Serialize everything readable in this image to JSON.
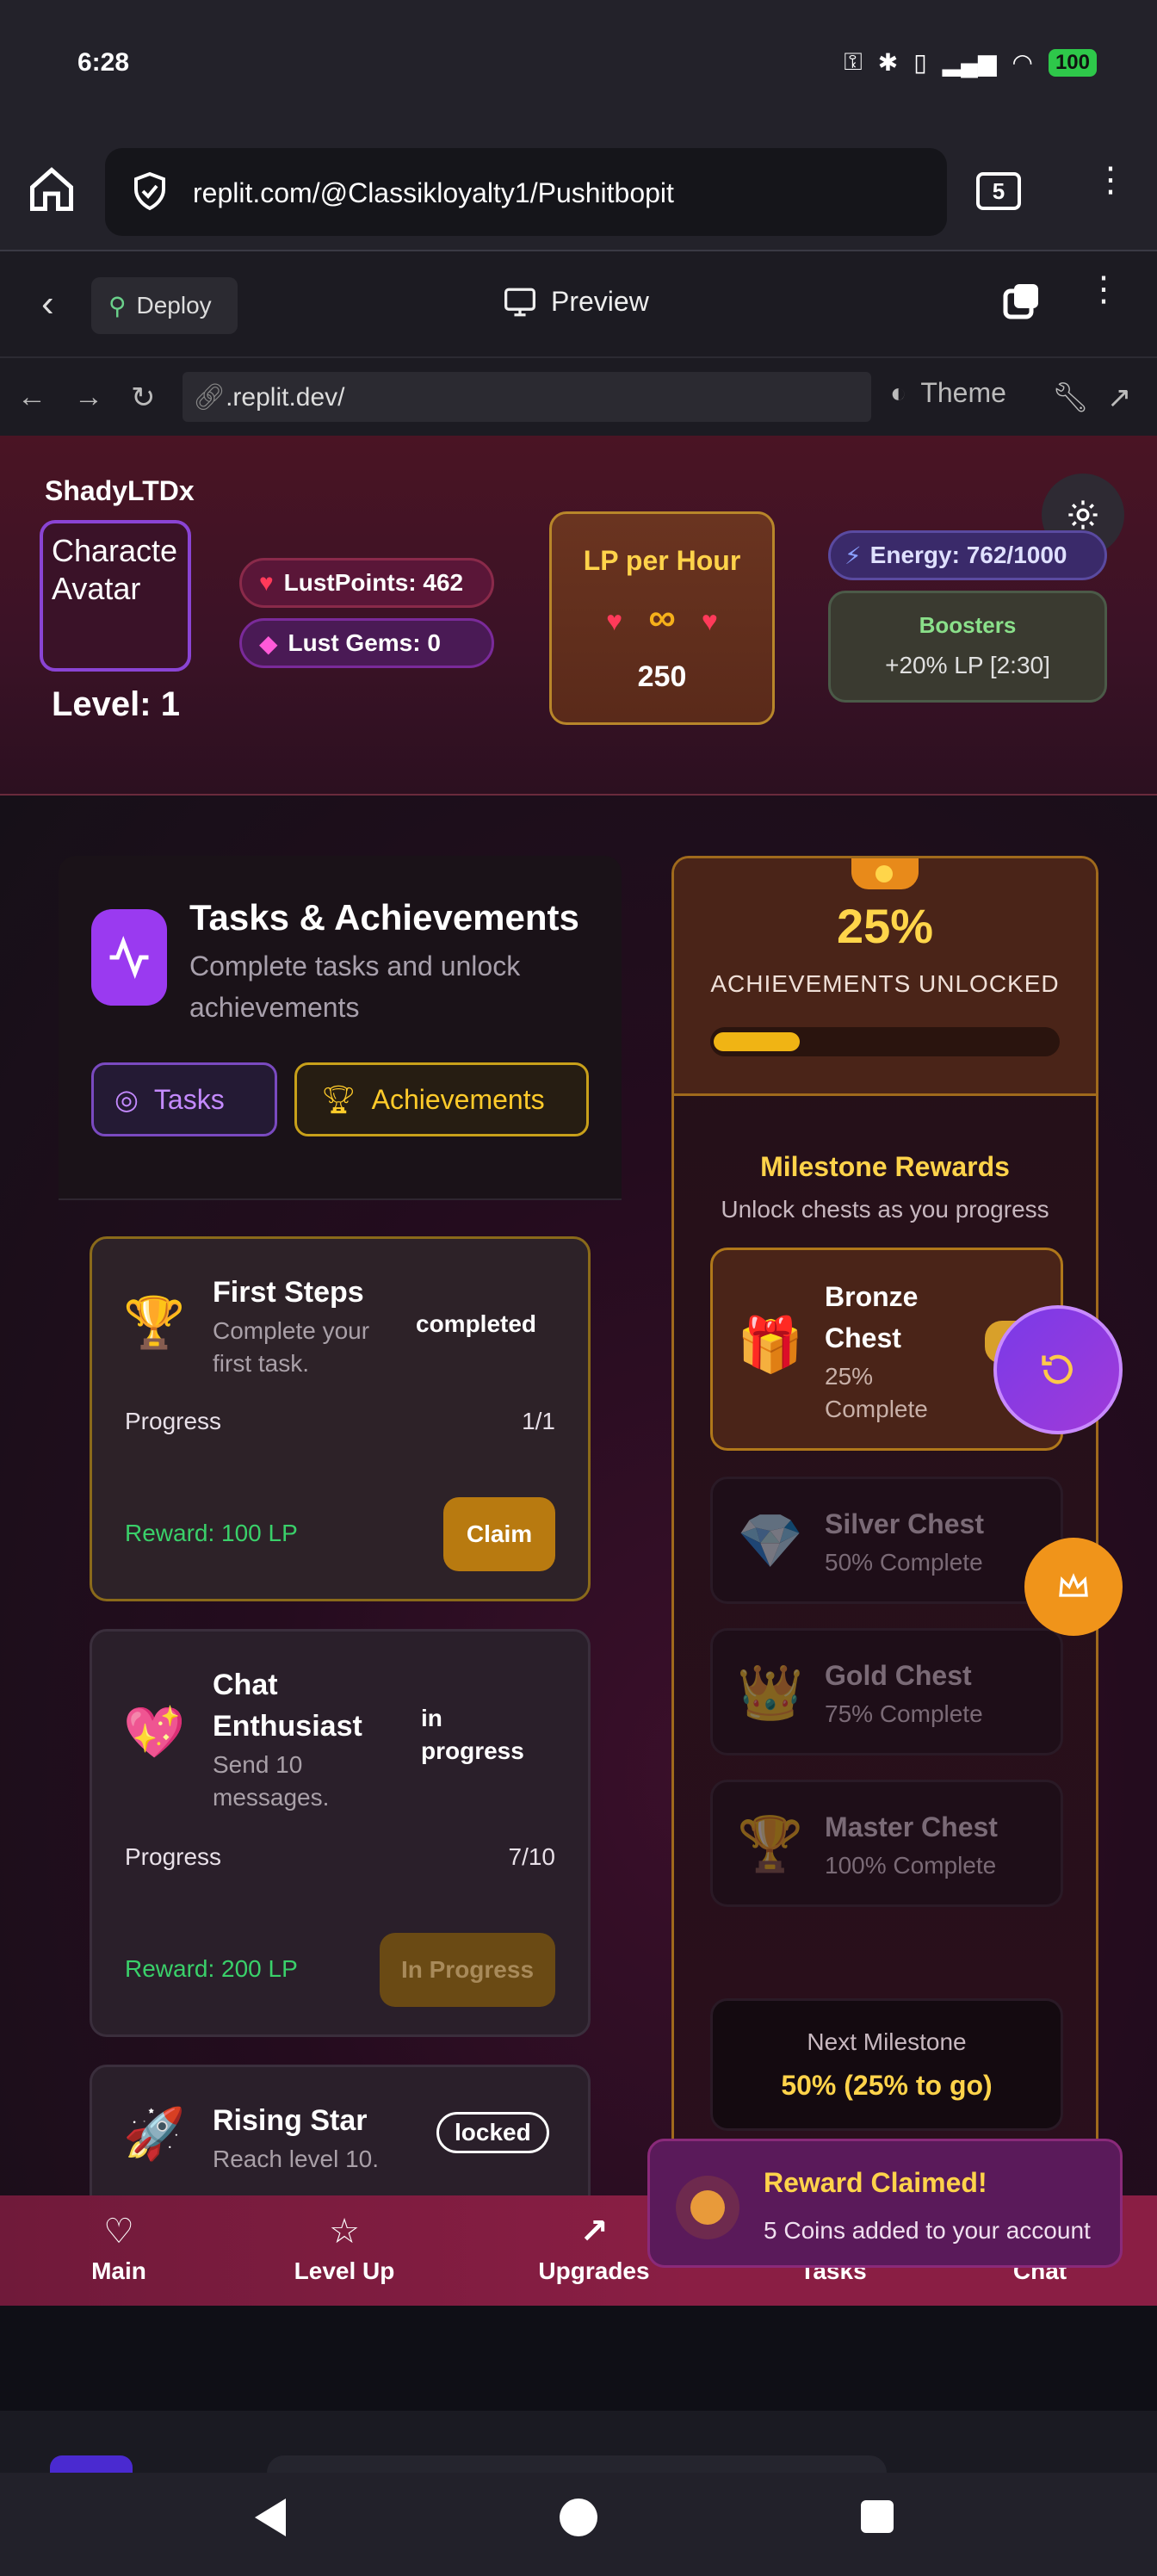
{
  "status_bar": {
    "time": "6:28",
    "battery": "100"
  },
  "browser": {
    "url": "replit.com/@Classikloyalty1/Pushitbopit",
    "tab_count": "5"
  },
  "replit": {
    "deploy_label": "Deploy",
    "preview_label": "Preview",
    "address": ".replit.dev/",
    "theme_label": "Theme"
  },
  "header": {
    "username": "ShadyLTDx",
    "avatar_text": "Characte Avatar",
    "level": "Level: 1",
    "lust_points": "LustPoints: 462",
    "lust_gems": "Lust Gems: 0",
    "lp_hour_title": "LP per Hour",
    "lp_hour_symbol": "∞",
    "lp_hour_value": "250",
    "energy": "Energy: 762/1000",
    "boosters_title": "Boosters",
    "boosters_value": "+20% LP [2:30]"
  },
  "tasks_panel": {
    "title": "Tasks & Achievements",
    "subtitle": "Complete tasks and unlock achievements",
    "tab_tasks": "Tasks",
    "tab_achievements": "Achievements",
    "tasks": [
      {
        "emoji": "🏆",
        "title": "First Steps",
        "desc": "Complete your first task.",
        "status": "completed",
        "progress_label": "Progress",
        "progress": "1/1",
        "reward": "Reward: 100 LP",
        "button": "Claim"
      },
      {
        "emoji": "💖",
        "title": "Chat Enthusiast",
        "desc": "Send 10 messages.",
        "status": "in progress",
        "progress_label": "Progress",
        "progress": "7/10",
        "reward": "Reward: 200 LP",
        "button": "In Progress"
      },
      {
        "emoji": "🚀",
        "title": "Rising Star",
        "desc": "Reach level 10.",
        "status": "locked"
      }
    ]
  },
  "achievements_panel": {
    "percent": "25%",
    "percent_fraction": 0.25,
    "label": "ACHIEVEMENTS UNLOCKED",
    "milestone_title": "Milestone Rewards",
    "milestone_sub": "Unlock chests as you progress",
    "chests": [
      {
        "emoji": "🎁",
        "name": "Bronze Chest",
        "pct": "25% Complete"
      },
      {
        "emoji": "💎",
        "name": "Silver Chest",
        "pct": "50% Complete"
      },
      {
        "emoji": "👑",
        "name": "Gold Chest",
        "pct": "75% Complete"
      },
      {
        "emoji": "🏆",
        "name": "Master Chest",
        "pct": "100% Complete"
      }
    ],
    "next_label": "Next Milestone",
    "next_value": "50% (25% to go)"
  },
  "bottom_nav": [
    {
      "icon": "heart-icon",
      "label": "Main"
    },
    {
      "icon": "star-icon",
      "label": "Level Up"
    },
    {
      "icon": "trending-up-icon",
      "label": "Upgrades"
    },
    {
      "icon": "tasks-icon",
      "label": "Tasks"
    },
    {
      "icon": "chat-icon",
      "label": "Chat"
    }
  ],
  "toast": {
    "title": "Reward Claimed!",
    "message": "5 Coins added to your account"
  },
  "colors": {
    "accent_gold": "#ffd34a",
    "accent_purple": "#9a3af0",
    "bar_fill": "#f0b414",
    "reward_green": "#3ad06a"
  }
}
